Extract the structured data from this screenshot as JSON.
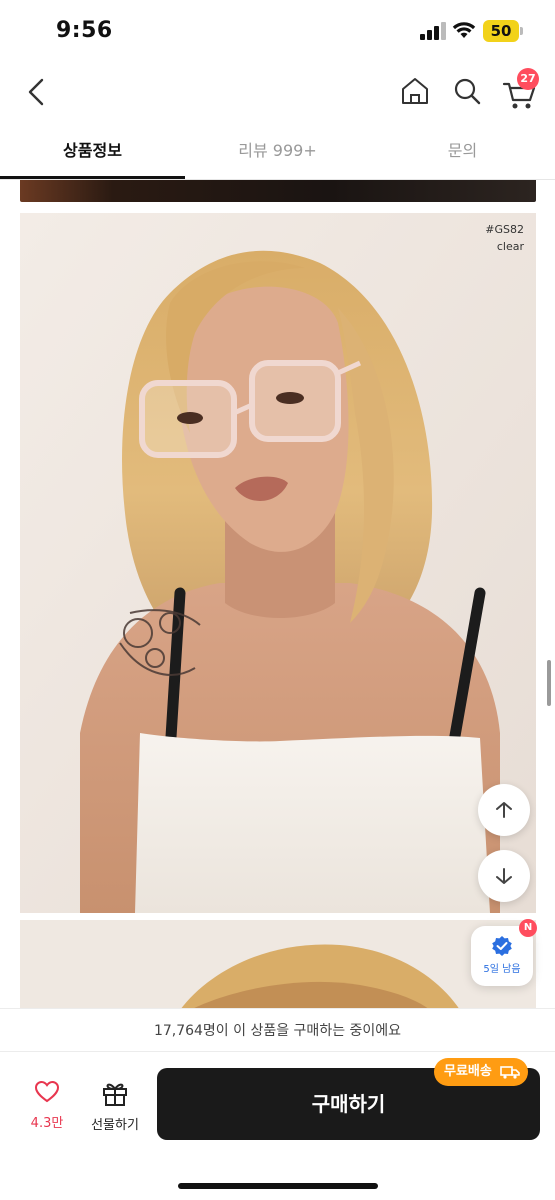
{
  "status_bar": {
    "time": "9:56",
    "battery": "50"
  },
  "header": {
    "cart_count": "27"
  },
  "tabs": [
    {
      "label": "상품정보",
      "active": true
    },
    {
      "label": "리뷰 999+",
      "active": false
    },
    {
      "label": "문의",
      "active": false
    }
  ],
  "photo": {
    "tag_code": "#GS82",
    "tag_color": "clear"
  },
  "coupon": {
    "label": "5일 남음",
    "badge": "N"
  },
  "social_proof": "17,764명이 이 상품을 구매하는 중이에요",
  "bottom_bar": {
    "like_count": "4.3만",
    "gift_label": "선물하기",
    "buy_label": "구매하기",
    "free_shipping_label": "무료배송"
  },
  "icons": {
    "back": "chevron-left-icon",
    "home": "home-icon",
    "search": "search-icon",
    "cart": "cart-icon",
    "heart": "heart-icon",
    "gift": "gift-icon",
    "scroll_up": "arrow-up-icon",
    "scroll_down": "arrow-down-icon",
    "verified": "verified-badge-icon",
    "truck": "truck-icon"
  },
  "colors": {
    "accent_red": "#ff4d5e",
    "buy_button": "#1a1a1a",
    "free_shipping": "#ff9c12",
    "coupon_blue": "#2b6fe0"
  }
}
